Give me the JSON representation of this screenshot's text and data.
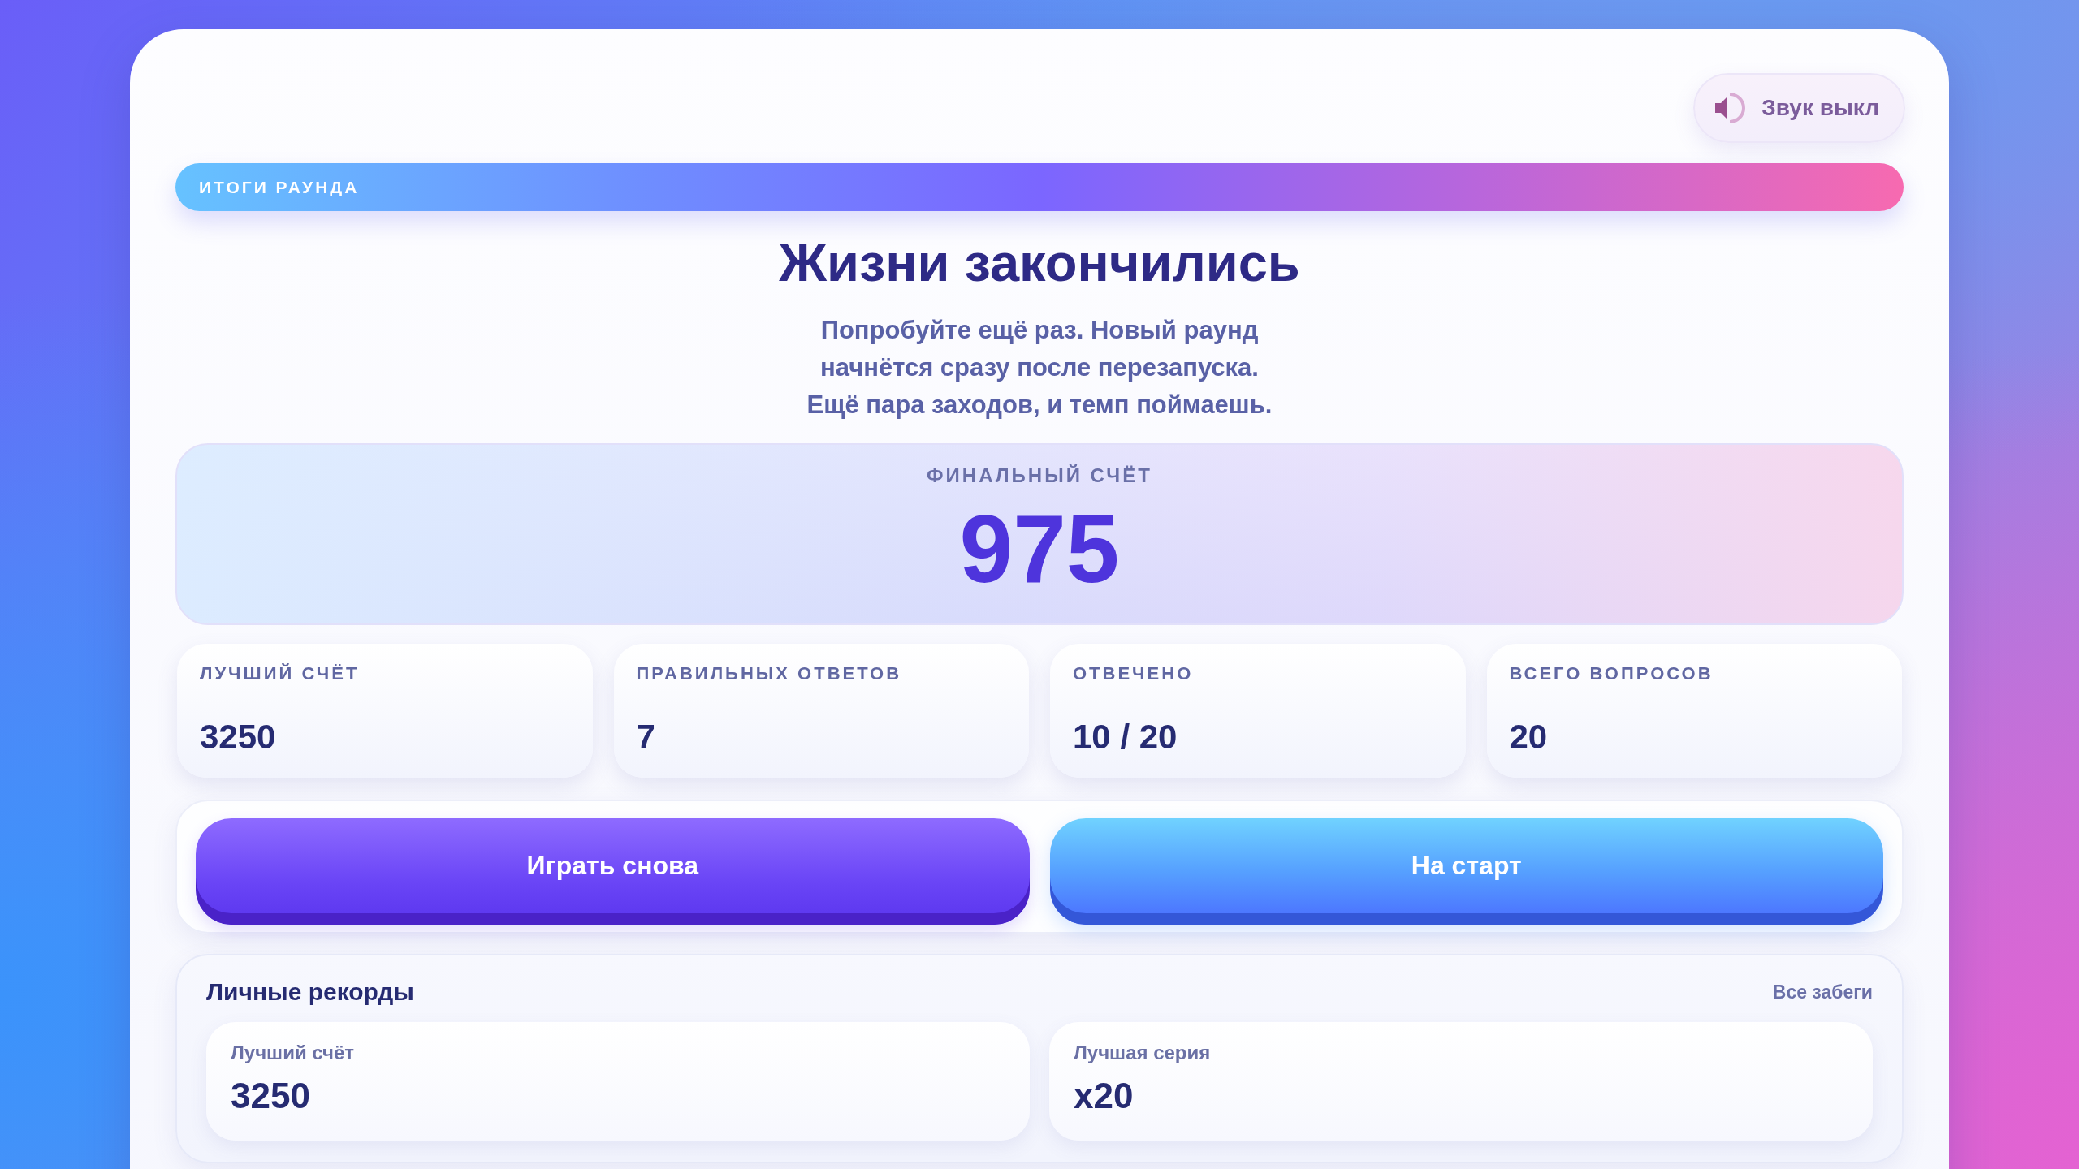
{
  "sound_toggle": {
    "label": "Звук выкл"
  },
  "banner": {
    "label": "ИТОГИ РАУНДА"
  },
  "title": "Жизни закончились",
  "message": "Попробуйте ещё раз. Новый раунд\nначнётся сразу после перезапуска.\nЕщё пара заходов, и темп поймаешь.",
  "final_score": {
    "label": "ФИНАЛЬНЫЙ СЧЁТ",
    "value": "975"
  },
  "stats": [
    {
      "label": "ЛУЧШИЙ СЧЁТ",
      "value": "3250"
    },
    {
      "label": "ПРАВИЛЬНЫХ ОТВЕТОВ",
      "value": "7"
    },
    {
      "label": "ОТВЕЧЕНО",
      "value": "10 / 20"
    },
    {
      "label": "ВСЕГО ВОПРОСОВ",
      "value": "20"
    }
  ],
  "actions": [
    {
      "label": "Играть снова",
      "kind": "primary"
    },
    {
      "label": "На старт",
      "kind": "secondary"
    }
  ],
  "records": {
    "title": "Личные рекорды",
    "link": "Все забеги",
    "items": [
      {
        "label": "Лучший счёт",
        "value": "3250"
      },
      {
        "label": "Лучшая серия",
        "value": "x20"
      }
    ]
  }
}
